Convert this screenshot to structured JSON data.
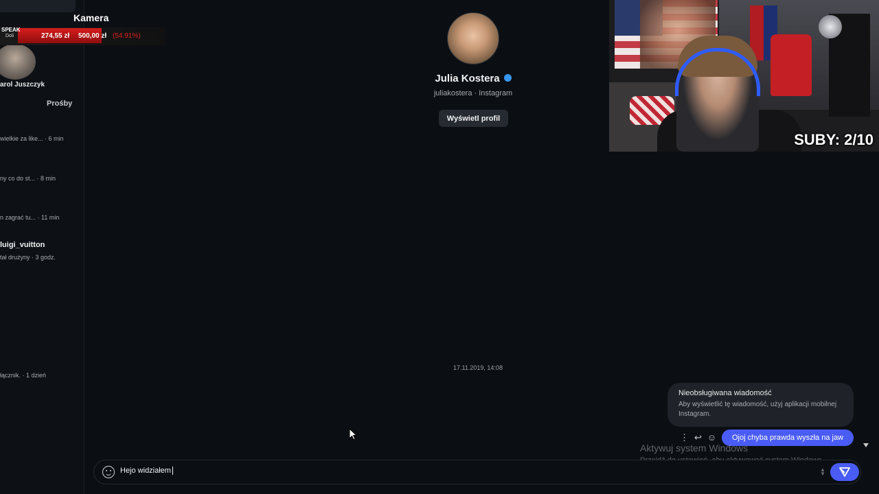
{
  "overlay": {
    "camera_label": "Kamera",
    "speak_label": "SPEAK",
    "speak_sub": "Doli",
    "donation_current": "274,55 zł",
    "donation_goal": "500,00 zł",
    "donation_percent": "(54.91%)",
    "subs": "SUBY: 2/10"
  },
  "sidebar": {
    "profile_name": "arol Juszczyk",
    "requests_label": "Prośby",
    "items": [
      {
        "preview": "wielkie za like... · 6 min"
      },
      {
        "preview": "ny co do st... · 8 min"
      },
      {
        "preview": "n zagrać tu... · 11 min"
      },
      {
        "title": "luigi_vuitton",
        "preview": "tał drużyny · 3 godz."
      },
      {
        "preview": "łącznik. · 1 dzień"
      }
    ]
  },
  "chat": {
    "name": "Julia Kostera",
    "subtitle": "juliakostera · Instagram",
    "view_profile": "Wyświetl profil",
    "timestamp": "17.11.2019, 14:08",
    "unsupported_title": "Nieobsługiwana wiadomość",
    "unsupported_body": "Aby wyświetlić tę wiadomość, użyj aplikacji mobilnej Instagram.",
    "sent_message": "Ojoj chyba prawda wyszła na jaw",
    "composer_value": "Hejo widziałem"
  },
  "watermark": {
    "title": "Aktywuj system Windows",
    "subtitle": "Przejdź do ustawień, aby aktywować system Windows."
  },
  "colors": {
    "accent": "#4a5cf6",
    "verified": "#3797f0",
    "donation_red": "#d61d1d"
  }
}
